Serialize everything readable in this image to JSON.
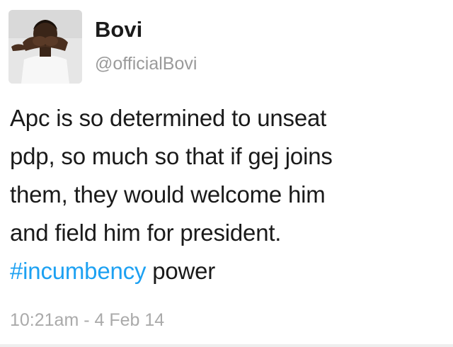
{
  "tweet": {
    "author": {
      "name": "Bovi",
      "handle": "@officialBovi"
    },
    "text_lines": [
      "Apc is so determined to unseat",
      "pdp, so much so that if gej joins",
      "them, they would welcome him",
      "and field him for president."
    ],
    "hashtag": "#incumbency",
    "after_hashtag": " power",
    "timestamp": "10:21am - 4 Feb 14"
  },
  "colors": {
    "hashtag": "#1da1f2",
    "text": "#1a1a1a",
    "muted": "#9a9a9a"
  }
}
